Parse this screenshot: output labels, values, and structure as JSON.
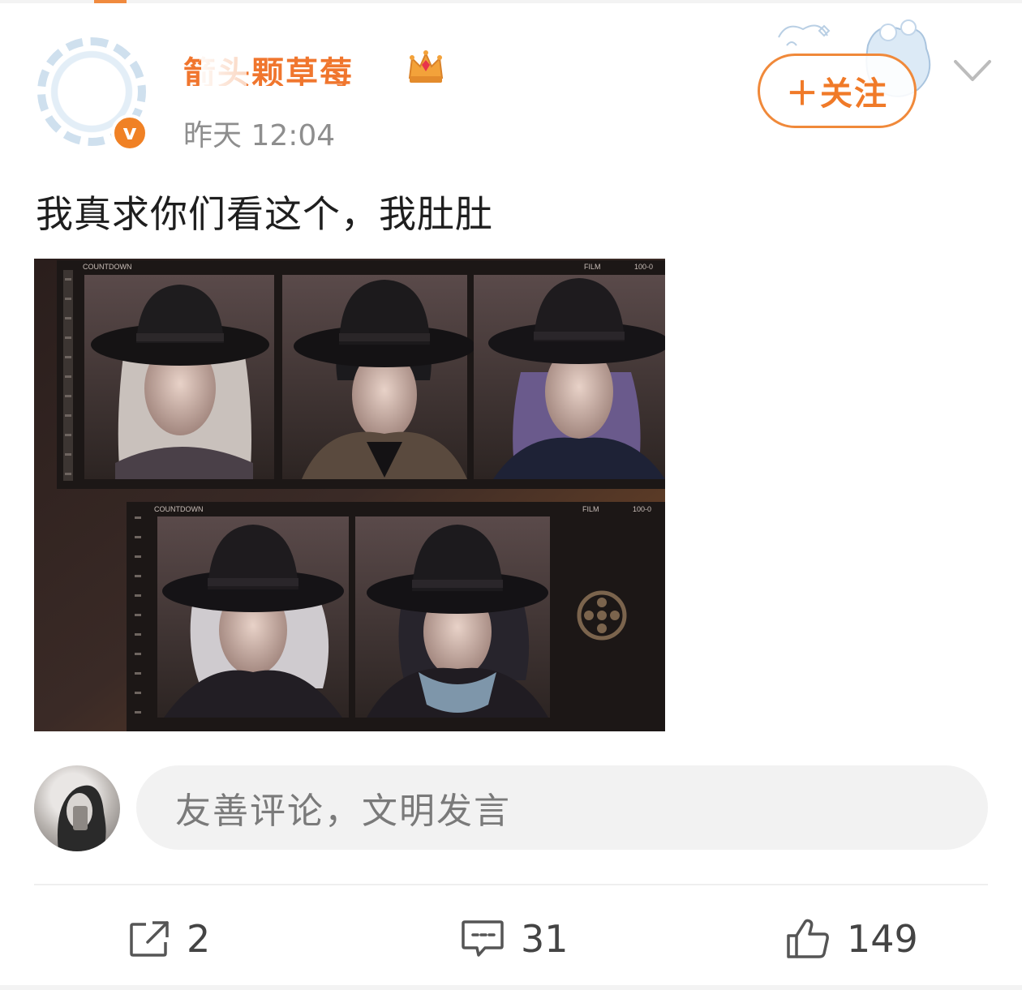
{
  "header": {
    "username": "箭头颗草莓_",
    "timestamp": "昨天 12:04",
    "verified_icon": "verified-v-icon",
    "crown_icon": "crown-icon",
    "follow_label": "＋关注",
    "more_icon": "chevron-down-icon"
  },
  "post": {
    "text": "我真求你们看这个，我肚肚",
    "image": {
      "label_countdown": "COUNTDOWN",
      "label_film": "FILM",
      "label_frame": "100-0"
    }
  },
  "comment": {
    "placeholder": "友善评论，文明发言"
  },
  "actions": {
    "share_count": "2",
    "comment_count": "31",
    "like_count": "149"
  },
  "colors": {
    "accent": "#f07a28",
    "username": "#f0762e",
    "text": "#1e1e1e",
    "muted": "#8e8e8e",
    "input_bg": "#f2f2f2"
  }
}
